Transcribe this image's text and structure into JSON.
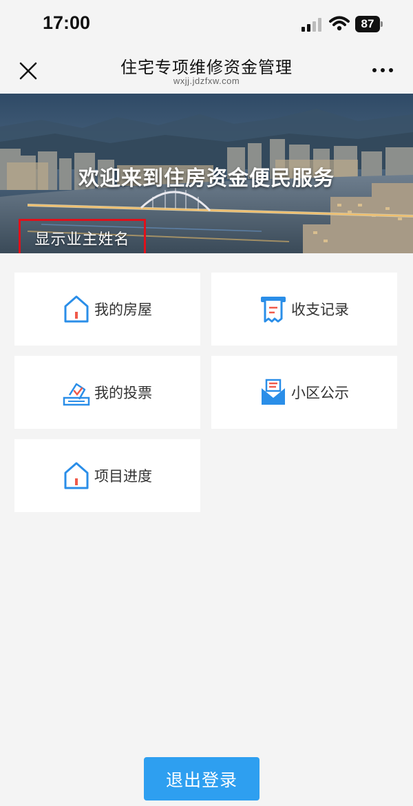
{
  "status_bar": {
    "time": "17:00",
    "battery": "87",
    "icons": [
      "signal-icon",
      "wifi-icon",
      "battery-icon"
    ]
  },
  "nav": {
    "title": "住宅专项维修资金管理",
    "url": "wxjj.jdzfxw.com",
    "close_icon": "close-icon",
    "more_icon": "more-icon"
  },
  "banner": {
    "title": "欢迎来到住房资金便民服务",
    "owner_name": "显示业主姓名",
    "highlight_color": "#e0101a"
  },
  "menu": {
    "items": [
      {
        "label": "我的房屋",
        "icon": "house-icon"
      },
      {
        "label": "收支记录",
        "icon": "receipt-icon"
      },
      {
        "label": "我的投票",
        "icon": "ballot-icon"
      },
      {
        "label": "小区公示",
        "icon": "notice-envelope-icon"
      },
      {
        "label": "项目进度",
        "icon": "house-icon"
      }
    ]
  },
  "logout": {
    "label": "退出登录"
  },
  "colors": {
    "accent": "#2e9ff0",
    "icon_blue": "#2a8ee8",
    "icon_red": "#f05a4a",
    "background": "#f4f4f4"
  }
}
